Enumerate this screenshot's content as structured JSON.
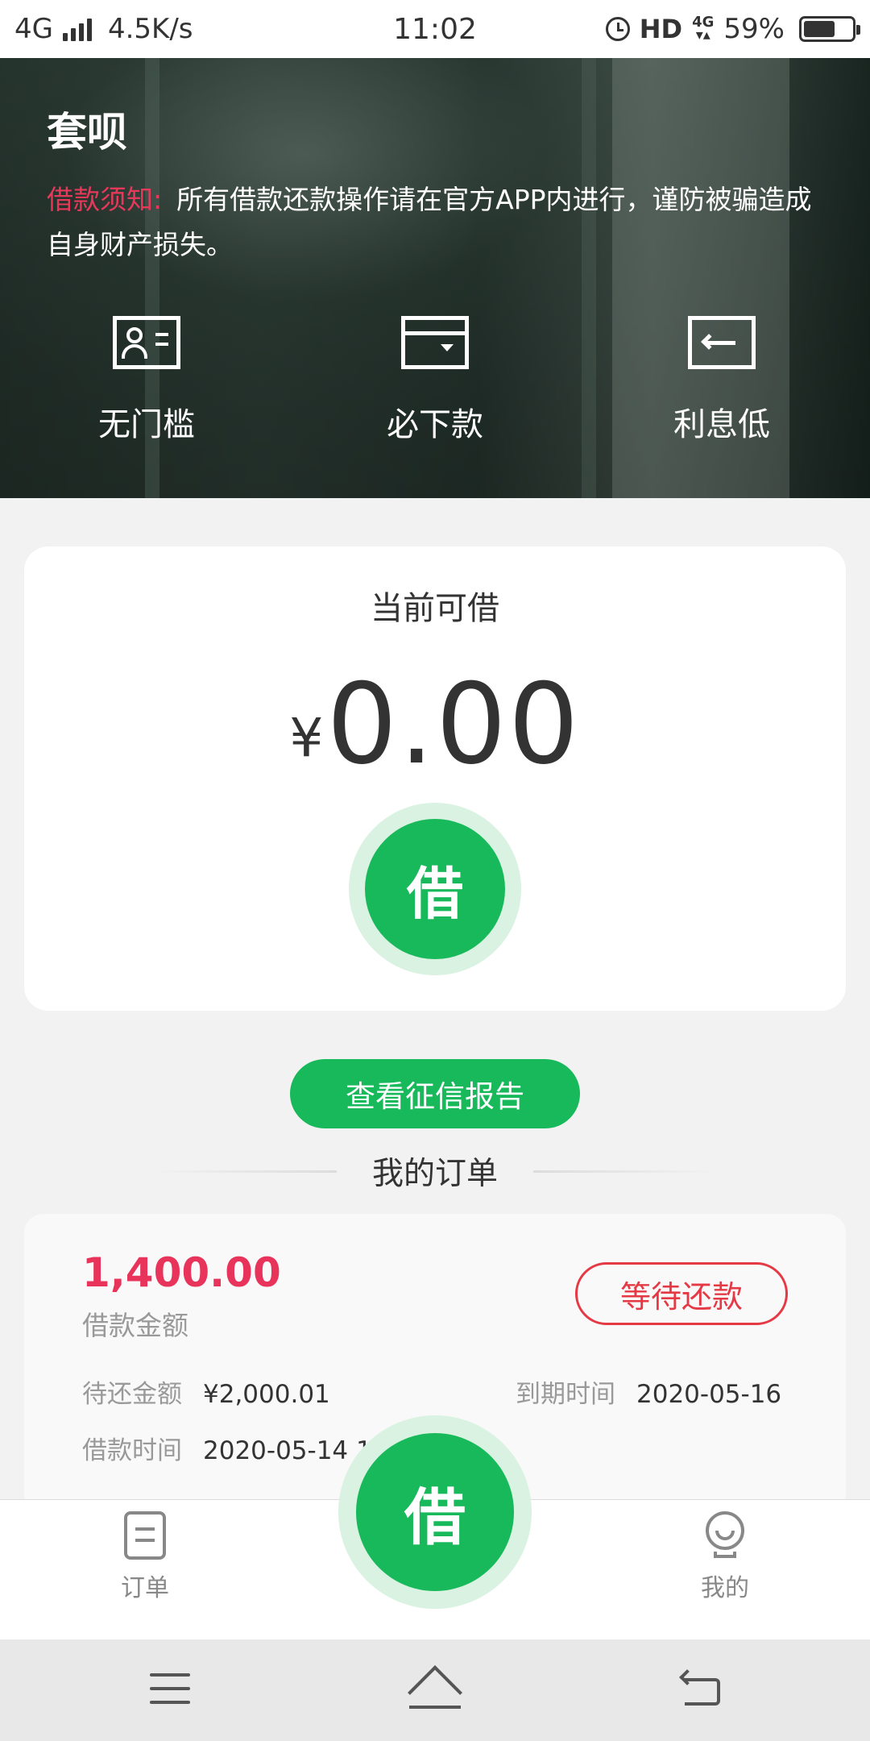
{
  "status_bar": {
    "network": "4G",
    "speed": "4.5K/s",
    "time": "11:02",
    "hd": "HD",
    "net_type": "4G",
    "battery": "59%"
  },
  "hero": {
    "title": "套呗",
    "notice_label": "借款须知:",
    "notice_text": "所有借款还款操作请在官方APP内进行，谨防被骗造成自身财产损失。",
    "features": [
      {
        "label": "无门槛",
        "icon": "id-card-icon"
      },
      {
        "label": "必下款",
        "icon": "wallet-icon"
      },
      {
        "label": "利息低",
        "icon": "rate-icon"
      }
    ]
  },
  "card": {
    "title": "当前可借",
    "currency": "¥",
    "amount": "0.00",
    "borrow_label": "借"
  },
  "credit_button": "查看征信报告",
  "orders": {
    "title": "我的订单",
    "items": [
      {
        "amount": "1,400.00",
        "amount_label": "借款金额",
        "status": "等待还款",
        "due_amount_label": "待还金额",
        "due_amount": "¥2,000.01",
        "due_date_label": "到期时间",
        "due_date": "2020-05-16",
        "loan_time_label": "借款时间",
        "loan_time": "2020-05-14 1"
      }
    ]
  },
  "tabbar": {
    "orders": "订单",
    "borrow": "借",
    "mine": "我的"
  },
  "colors": {
    "primary_green": "#18b95b",
    "light_green": "#d9f2e2",
    "accent_red": "#e8335a",
    "status_red": "#e53945"
  }
}
